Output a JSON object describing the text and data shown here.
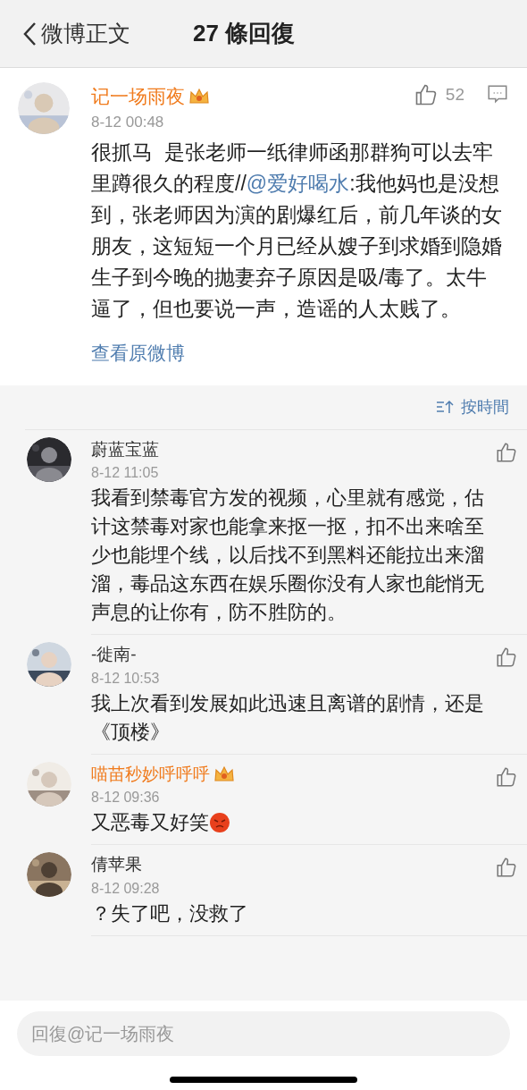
{
  "header": {
    "back_label": "微博正文",
    "title": "27 條回復"
  },
  "post": {
    "author": "记一场雨夜",
    "vip": true,
    "time": "8-12 00:48",
    "likes": "52",
    "body": [
      {
        "kind": "text",
        "text": "很抓马  是张老师一纸律师函那群狗可以去牢里蹲很久的程度//"
      },
      {
        "kind": "mention",
        "text": "@爱好喝水"
      },
      {
        "kind": "text",
        "text": ":我他妈也是没想到，张老师因为演的剧爆红后，前几年谈的女朋友，这短短一个月已经从嫂子到求婚到隐婚生子到今晚的抛妻弃子原因是吸/毒了。太牛逼了，但也要说一声，造谣的人太贱了。"
      }
    ],
    "view_original": "查看原微博"
  },
  "sort": {
    "label": "按時間"
  },
  "comments": [
    {
      "author": "蔚蓝宝蓝",
      "vip": false,
      "time": "8-12 11:05",
      "text": "我看到禁毒官方发的视频，心里就有感觉，估计这禁毒对家也能拿来抠一抠，扣不出来啥至少也能埋个线，以后找不到黑料还能拉出来溜溜，毒品这东西在娱乐圈你没有人家也能悄无声息的让你有，防不胜防的。",
      "emoji": false
    },
    {
      "author": "-徙南-",
      "vip": false,
      "time": "8-12 10:53",
      "text": "我上次看到发展如此迅速且离谱的剧情，还是《顶楼》",
      "emoji": false
    },
    {
      "author": "喵苗秒妙呼呼呼",
      "vip": true,
      "time": "8-12 09:36",
      "text": "又恶毒又好笑",
      "emoji": true
    },
    {
      "author": "倩苹果",
      "vip": false,
      "time": "8-12 09:28",
      "text": "？失了吧，没救了",
      "emoji": false
    }
  ],
  "reply": {
    "placeholder": "回復@记一场雨夜"
  }
}
